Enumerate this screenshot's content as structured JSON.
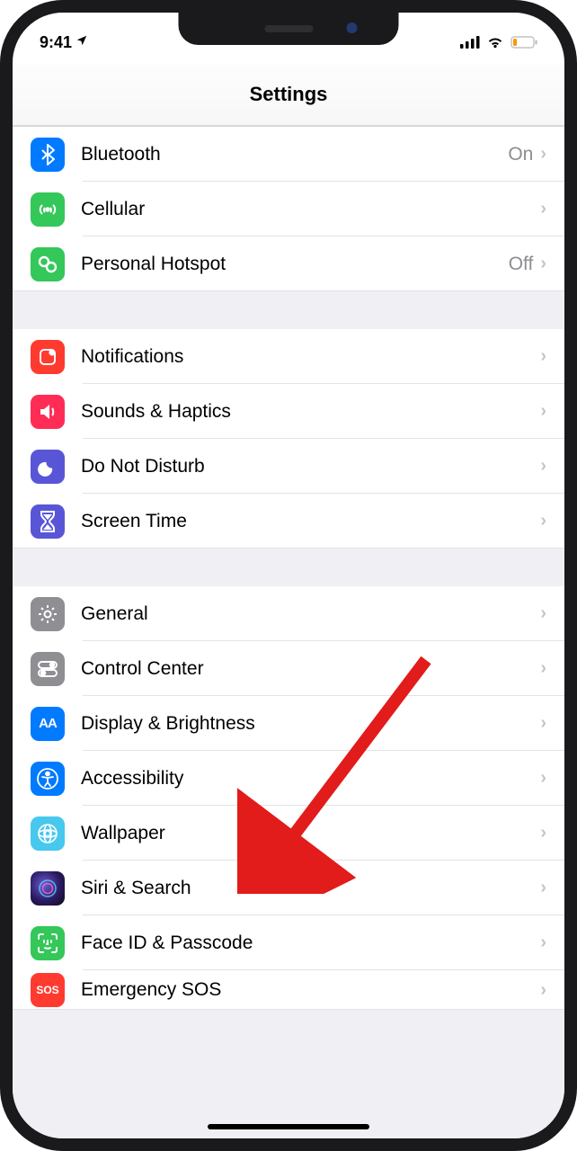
{
  "status": {
    "time": "9:41",
    "location_icon": "location-arrow"
  },
  "header": {
    "title": "Settings"
  },
  "groups": [
    {
      "items": [
        {
          "key": "bluetooth",
          "label": "Bluetooth",
          "value": "On",
          "color": "#007aff"
        },
        {
          "key": "cellular",
          "label": "Cellular",
          "value": "",
          "color": "#34c759"
        },
        {
          "key": "hotspot",
          "label": "Personal Hotspot",
          "value": "Off",
          "color": "#34c759"
        }
      ]
    },
    {
      "items": [
        {
          "key": "notifications",
          "label": "Notifications",
          "value": "",
          "color": "#ff3b30"
        },
        {
          "key": "sounds",
          "label": "Sounds & Haptics",
          "value": "",
          "color": "#ff2d55"
        },
        {
          "key": "dnd",
          "label": "Do Not Disturb",
          "value": "",
          "color": "#5856d6"
        },
        {
          "key": "screentime",
          "label": "Screen Time",
          "value": "",
          "color": "#5856d6"
        }
      ]
    },
    {
      "items": [
        {
          "key": "general",
          "label": "General",
          "value": "",
          "color": "#8e8e93"
        },
        {
          "key": "controlcenter",
          "label": "Control Center",
          "value": "",
          "color": "#8e8e93"
        },
        {
          "key": "display",
          "label": "Display & Brightness",
          "value": "",
          "color": "#007aff"
        },
        {
          "key": "accessibility",
          "label": "Accessibility",
          "value": "",
          "color": "#007aff"
        },
        {
          "key": "wallpaper",
          "label": "Wallpaper",
          "value": "",
          "color": "#47c8ee"
        },
        {
          "key": "siri",
          "label": "Siri & Search",
          "value": "",
          "color": "#222233"
        },
        {
          "key": "faceid",
          "label": "Face ID & Passcode",
          "value": "",
          "color": "#34c759"
        },
        {
          "key": "sos",
          "label": "Emergency SOS",
          "value": "",
          "color": "#ff3b30"
        }
      ]
    }
  ],
  "annotation": {
    "target": "accessibility"
  }
}
